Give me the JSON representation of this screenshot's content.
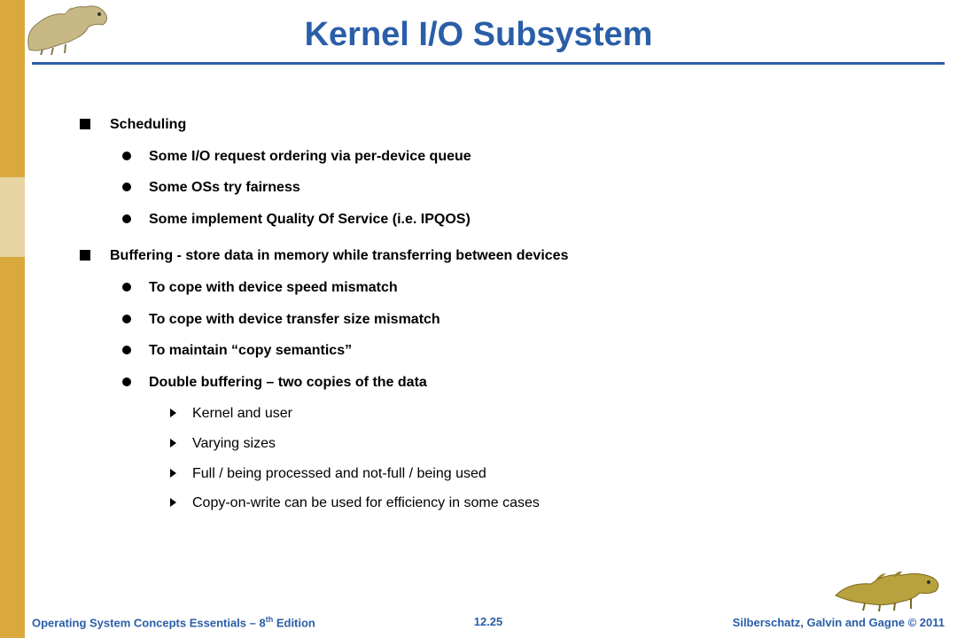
{
  "title": "Kernel I/O Subsystem",
  "bullets": [
    {
      "text": "Scheduling",
      "sub": [
        {
          "text": "Some I/O request ordering via per-device queue"
        },
        {
          "text": "Some OSs try fairness"
        },
        {
          "text": "Some implement Quality Of Service (i.e. IPQOS)"
        }
      ]
    },
    {
      "text": "Buffering - store data in memory while transferring between devices",
      "sub": [
        {
          "text": "To cope with device speed mismatch"
        },
        {
          "text": "To cope with device transfer size mismatch"
        },
        {
          "text": "To maintain “copy semantics”"
        },
        {
          "text": "Double buffering – two copies of the data",
          "sub": [
            {
              "text": "Kernel and user"
            },
            {
              "text": "Varying sizes"
            },
            {
              "text": "Full  / being processed and not-full / being used"
            },
            {
              "text": "Copy-on-write can be used for efficiency in some cases"
            }
          ]
        }
      ]
    }
  ],
  "footer": {
    "left_pre": "Operating System Concepts Essentials – 8",
    "left_sup": "th",
    "left_post": " Edition",
    "center": "12.25",
    "right": "Silberschatz, Galvin and Gagne © 2011"
  }
}
